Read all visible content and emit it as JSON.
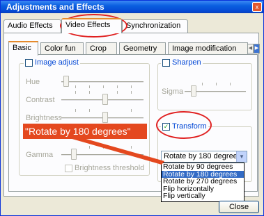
{
  "window": {
    "title": "Adjustments and Effects",
    "close_glyph": "x"
  },
  "tabs": [
    "Audio Effects",
    "Video Effects",
    "Synchronization"
  ],
  "subtabs": [
    "Basic",
    "Color fun",
    "Crop",
    "Geometry",
    "Image modification"
  ],
  "image_adjust": {
    "label": "Image adjust",
    "hue_label": "Hue",
    "contrast_label": "Contrast",
    "brightness_label": "Brightness",
    "gamma_label": "Gamma",
    "brightness_threshold_label": "Brightness threshold"
  },
  "sharpen": {
    "label": "Sharpen",
    "sigma_label": "Sigma"
  },
  "transform": {
    "label": "Transform",
    "checked": true,
    "selected": "Rotate by 180 degrees",
    "options": [
      "Rotate by 90 degrees",
      "Rotate by 180 degrees",
      "Rotate by 270 degrees",
      "Flip horizontally",
      "Flip vertically"
    ]
  },
  "callout": {
    "text": "\"Rotate by 180 degrees\""
  },
  "close_button": "Close",
  "colors": {
    "highlight": "#e02020",
    "callout_bg": "#e4481f",
    "selection": "#316ac5",
    "active_tab": "#e68b2c"
  }
}
